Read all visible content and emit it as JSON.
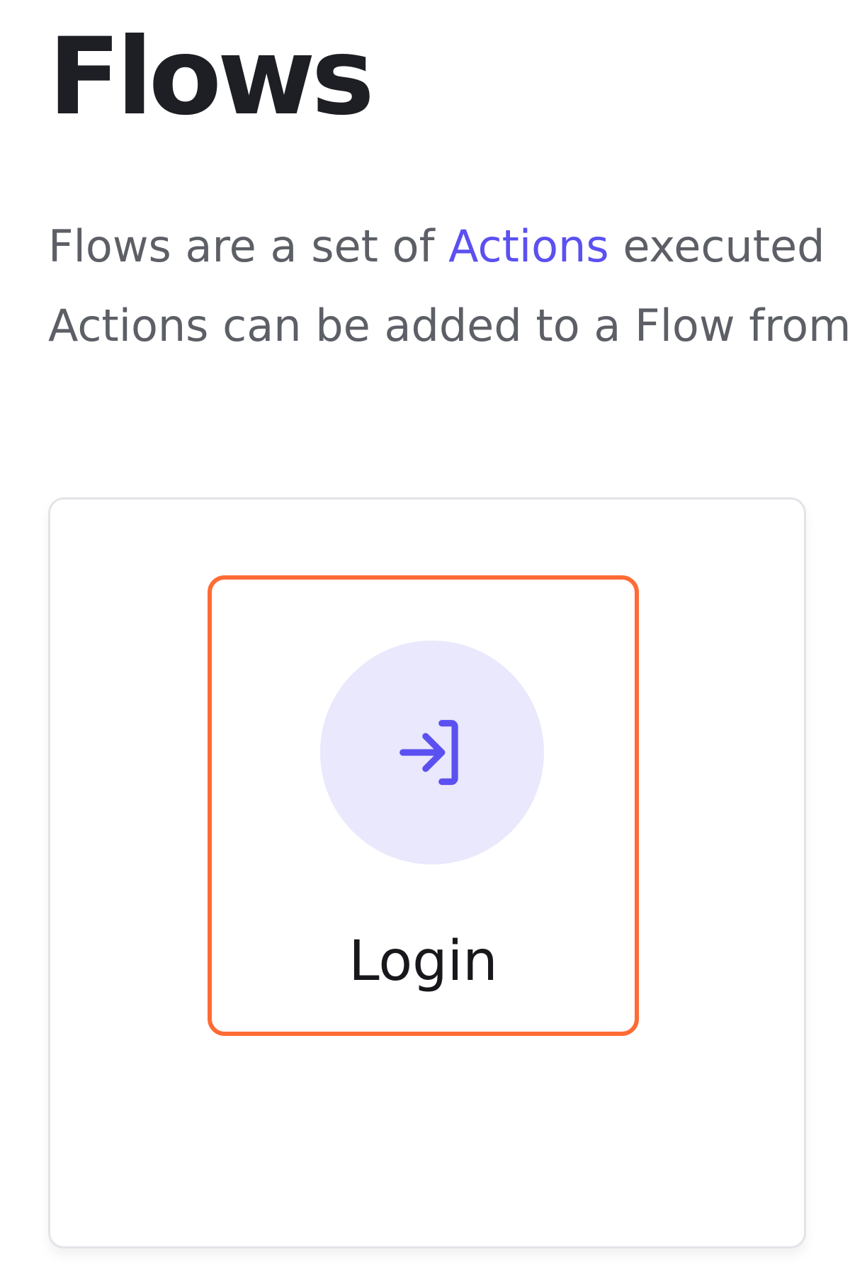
{
  "page": {
    "title": "Flows",
    "description": {
      "line1_prefix": "Flows are a set of ",
      "line1_link": "Actions",
      "line1_suffix": " executed",
      "line2": "Actions can be added to a Flow from"
    }
  },
  "flows": [
    {
      "label": "Login",
      "icon": "login-icon",
      "selected": true
    }
  ],
  "colors": {
    "accent": "#5b50f0",
    "selected_outline": "#ff6b35",
    "icon_background": "#e9e8fc",
    "title_text": "#1d1f24",
    "body_text": "#5d5f66"
  }
}
